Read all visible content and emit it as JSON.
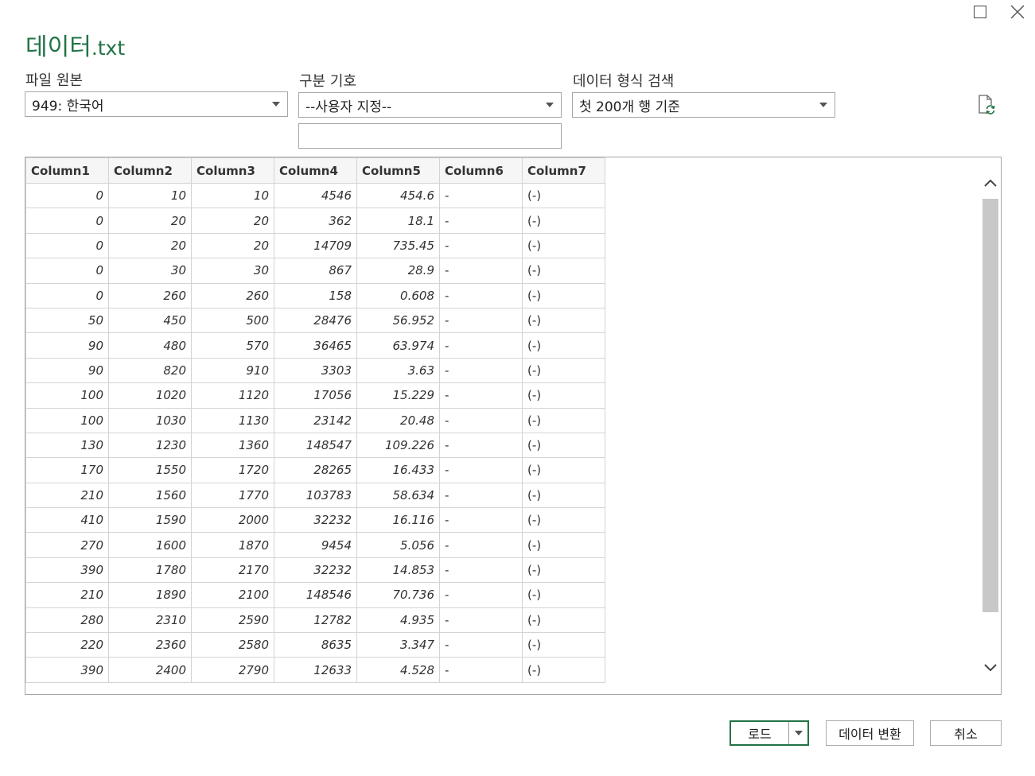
{
  "window": {
    "title_name": "데이터",
    "title_ext": ".txt",
    "maximize_icon": "maximize-icon",
    "close_icon": "close-icon"
  },
  "options": {
    "file_origin": {
      "label": "파일 원본",
      "value": "949: 한국어"
    },
    "delimiter": {
      "label": "구분 기호",
      "value": "--사용자 지정--",
      "custom_value": ""
    },
    "type_detection": {
      "label": "데이터 형식 검색",
      "value": "첫 200개 행 기준"
    },
    "refresh_icon": "refresh-file-icon"
  },
  "preview": {
    "columns": [
      "Column1",
      "Column2",
      "Column3",
      "Column4",
      "Column5",
      "Column6",
      "Column7"
    ],
    "rows": [
      [
        "0",
        "10",
        "10",
        "4546",
        "454.6",
        "-",
        "(-)"
      ],
      [
        "0",
        "20",
        "20",
        "362",
        "18.1",
        "-",
        "(-)"
      ],
      [
        "0",
        "20",
        "20",
        "14709",
        "735.45",
        "-",
        "(-)"
      ],
      [
        "0",
        "30",
        "30",
        "867",
        "28.9",
        "-",
        "(-)"
      ],
      [
        "0",
        "260",
        "260",
        "158",
        "0.608",
        "-",
        "(-)"
      ],
      [
        "50",
        "450",
        "500",
        "28476",
        "56.952",
        "-",
        "(-)"
      ],
      [
        "90",
        "480",
        "570",
        "36465",
        "63.974",
        "-",
        "(-)"
      ],
      [
        "90",
        "820",
        "910",
        "3303",
        "3.63",
        "-",
        "(-)"
      ],
      [
        "100",
        "1020",
        "1120",
        "17056",
        "15.229",
        "-",
        "(-)"
      ],
      [
        "100",
        "1030",
        "1130",
        "23142",
        "20.48",
        "-",
        "(-)"
      ],
      [
        "130",
        "1230",
        "1360",
        "148547",
        "109.226",
        "-",
        "(-)"
      ],
      [
        "170",
        "1550",
        "1720",
        "28265",
        "16.433",
        "-",
        "(-)"
      ],
      [
        "210",
        "1560",
        "1770",
        "103783",
        "58.634",
        "-",
        "(-)"
      ],
      [
        "410",
        "1590",
        "2000",
        "32232",
        "16.116",
        "-",
        "(-)"
      ],
      [
        "270",
        "1600",
        "1870",
        "9454",
        "5.056",
        "-",
        "(-)"
      ],
      [
        "390",
        "1780",
        "2170",
        "32232",
        "14.853",
        "-",
        "(-)"
      ],
      [
        "210",
        "1890",
        "2100",
        "148546",
        "70.736",
        "-",
        "(-)"
      ],
      [
        "280",
        "2310",
        "2590",
        "12782",
        "4.935",
        "-",
        "(-)"
      ],
      [
        "220",
        "2360",
        "2580",
        "8635",
        "3.347",
        "-",
        "(-)"
      ],
      [
        "390",
        "2400",
        "2790",
        "12633",
        "4.528",
        "-",
        "(-)"
      ]
    ]
  },
  "buttons": {
    "load": "로드",
    "transform": "데이터 변환",
    "cancel": "취소"
  },
  "colors": {
    "accent": "#217346",
    "border": "#a6a6a6",
    "scrollbar": "#c8c8c8"
  }
}
